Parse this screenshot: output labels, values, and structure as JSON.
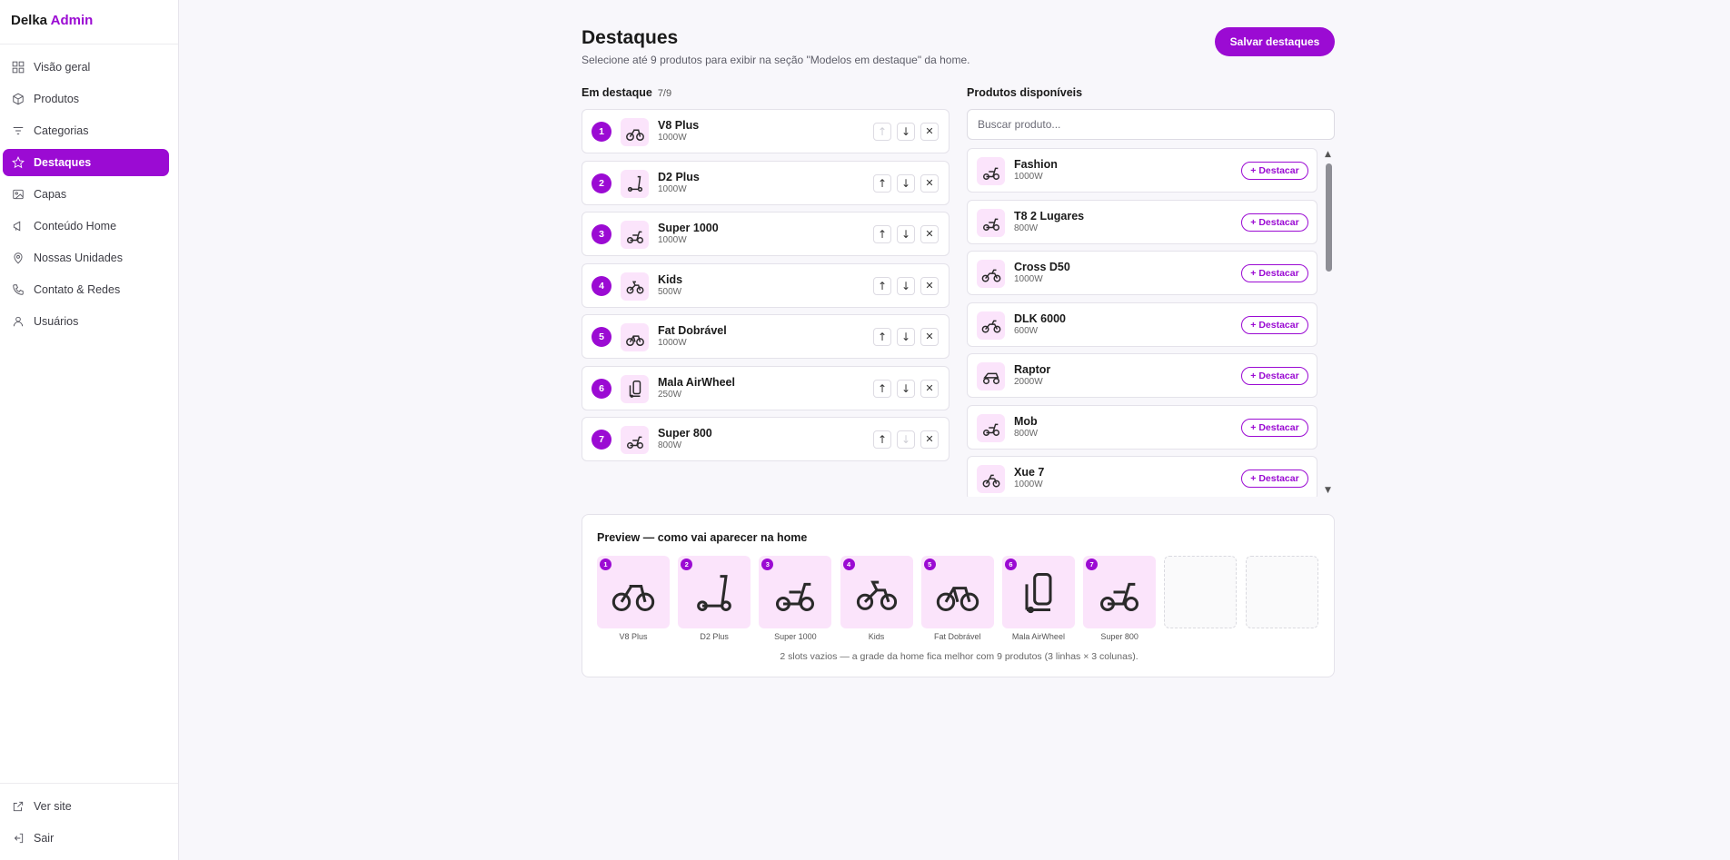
{
  "brand": {
    "name": "Delka",
    "accent": "Admin"
  },
  "nav": [
    {
      "label": "Visão geral",
      "icon": "grid-icon",
      "active": false
    },
    {
      "label": "Produtos",
      "icon": "box-icon",
      "active": false
    },
    {
      "label": "Categorias",
      "icon": "filter-icon",
      "active": false
    },
    {
      "label": "Destaques",
      "icon": "star-icon",
      "active": true
    },
    {
      "label": "Capas",
      "icon": "image-icon",
      "active": false
    },
    {
      "label": "Conteúdo Home",
      "icon": "megaphone-icon",
      "active": false
    },
    {
      "label": "Nossas Unidades",
      "icon": "map-pin-icon",
      "active": false
    },
    {
      "label": "Contato & Redes",
      "icon": "phone-icon",
      "active": false
    },
    {
      "label": "Usuários",
      "icon": "user-icon",
      "active": false
    }
  ],
  "nav_bottom": [
    {
      "label": "Ver site",
      "icon": "external-link-icon"
    },
    {
      "label": "Sair",
      "icon": "logout-icon"
    }
  ],
  "page": {
    "title": "Destaques",
    "subtitle": "Selecione até 9 produtos para exibir na seção \"Modelos em destaque\" da home.",
    "save_label": "Salvar destaques"
  },
  "featured": {
    "title": "Em destaque",
    "count": "7/9",
    "items": [
      {
        "rank": "1",
        "name": "V8 Plus",
        "power": "1000W",
        "icon": "moped-icon"
      },
      {
        "rank": "2",
        "name": "D2 Plus",
        "power": "1000W",
        "icon": "kick-scooter-icon"
      },
      {
        "rank": "3",
        "name": "Super 1000",
        "power": "1000W",
        "icon": "scooter-icon"
      },
      {
        "rank": "4",
        "name": "Kids",
        "power": "500W",
        "icon": "kids-bike-icon"
      },
      {
        "rank": "5",
        "name": "Fat Dobrável",
        "power": "1000W",
        "icon": "fat-bike-icon"
      },
      {
        "rank": "6",
        "name": "Mala AirWheel",
        "power": "250W",
        "icon": "suitcase-scooter-icon"
      },
      {
        "rank": "7",
        "name": "Super 800",
        "power": "800W",
        "icon": "scooter-icon"
      }
    ]
  },
  "available": {
    "title": "Produtos disponíveis",
    "search_placeholder": "Buscar produto...",
    "button_label": "+ Destacar",
    "items": [
      {
        "name": "Fashion",
        "power": "1000W",
        "icon": "scooter-icon"
      },
      {
        "name": "T8 2 Lugares",
        "power": "800W",
        "icon": "scooter-icon"
      },
      {
        "name": "Cross D50",
        "power": "1000W",
        "icon": "dirt-bike-icon"
      },
      {
        "name": "DLK 6000",
        "power": "600W",
        "icon": "dirt-bike-icon"
      },
      {
        "name": "Raptor",
        "power": "2000W",
        "icon": "atv-icon"
      },
      {
        "name": "Mob",
        "power": "800W",
        "icon": "scooter-icon"
      },
      {
        "name": "Xue 7",
        "power": "1000W",
        "icon": "bike-icon"
      }
    ]
  },
  "preview": {
    "title": "Preview — como vai aparecer na home",
    "empty_slots": 2,
    "note": "2 slots vazios — a grade da home fica melhor com 9 produtos (3 linhas × 3 colunas)."
  },
  "colors": {
    "accent": "#9b0bd3",
    "thumb_bg": "#fbe4fb",
    "page_bg": "#f8f7fb"
  }
}
